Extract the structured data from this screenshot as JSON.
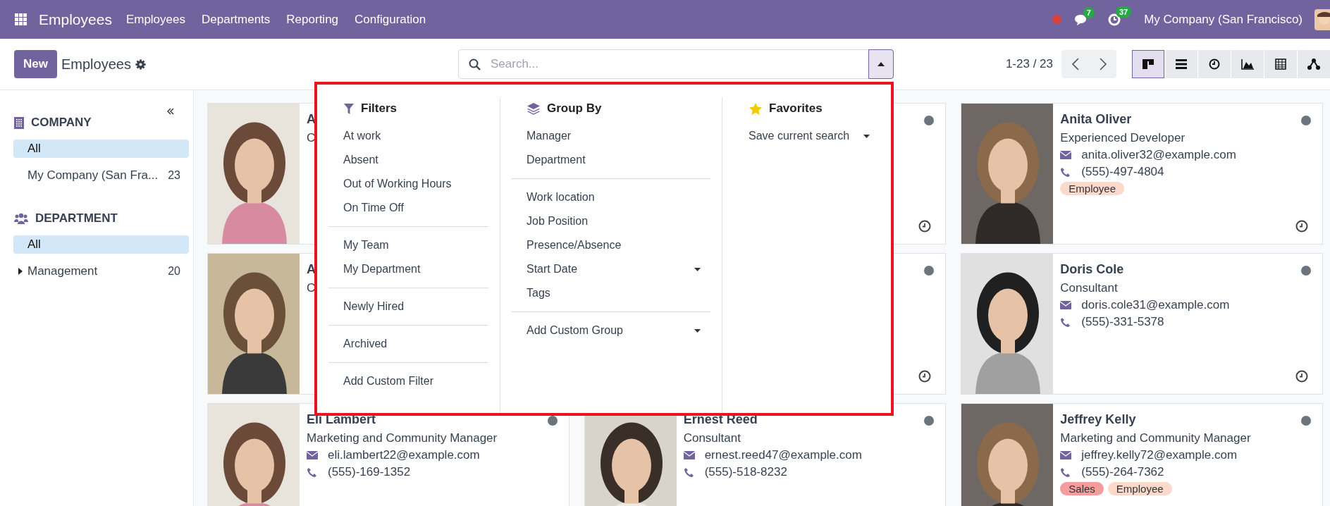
{
  "navbar": {
    "app_title": "Employees",
    "menu": [
      {
        "label": "Employees"
      },
      {
        "label": "Departments"
      },
      {
        "label": "Reporting"
      },
      {
        "label": "Configuration"
      }
    ],
    "messages_count": "7",
    "activities_count": "37",
    "company": "My Company (San Francisco)"
  },
  "control_panel": {
    "new_button": "New",
    "breadcrumb": "Employees",
    "search": {
      "placeholder": "Search...",
      "panel_open": true
    },
    "pager": "1-23 / 23",
    "views": [
      {
        "kind": "kanban",
        "selected": true
      },
      {
        "kind": "list",
        "selected": false
      },
      {
        "kind": "activity",
        "selected": false
      },
      {
        "kind": "graph",
        "selected": false
      },
      {
        "kind": "pivot",
        "selected": false
      },
      {
        "kind": "hierarchy",
        "selected": false
      }
    ]
  },
  "sidebar": {
    "sections": [
      {
        "kind": "company",
        "title": "COMPANY",
        "items": [
          {
            "label": "All",
            "selected": true
          },
          {
            "label": "My Company (San Fra...",
            "count": "23",
            "selected": false
          }
        ]
      },
      {
        "kind": "department",
        "title": "DEPARTMENT",
        "items": [
          {
            "label": "All",
            "selected": true
          },
          {
            "label": "Management",
            "count": "20",
            "selected": false,
            "expanded": false
          }
        ]
      }
    ]
  },
  "search_panel": {
    "filters": {
      "title": "Filters",
      "groups": [
        [
          {
            "label": "At work",
            "kind": "option"
          },
          {
            "label": "Absent",
            "kind": "option"
          },
          {
            "label": "Out of Working Hours",
            "kind": "option"
          },
          {
            "label": "On Time Off",
            "kind": "option"
          }
        ],
        [
          {
            "label": "My Team",
            "kind": "option"
          },
          {
            "label": "My Department",
            "kind": "option"
          }
        ],
        [
          {
            "label": "Newly Hired",
            "kind": "option"
          }
        ],
        [
          {
            "label": "Archived",
            "kind": "option"
          }
        ],
        [
          {
            "label": "Add Custom Filter",
            "kind": "option"
          }
        ]
      ]
    },
    "group_by": {
      "title": "Group By",
      "groups": [
        [
          {
            "label": "Manager",
            "kind": "option"
          },
          {
            "label": "Department",
            "kind": "option"
          }
        ],
        [
          {
            "label": "Work location",
            "kind": "option"
          },
          {
            "label": "Job Position",
            "kind": "option"
          },
          {
            "label": "Presence/Absence",
            "kind": "option"
          },
          {
            "label": "Start Date",
            "kind": "submenu"
          },
          {
            "label": "Tags",
            "kind": "option"
          }
        ],
        [
          {
            "label": "Add Custom Group",
            "kind": "submenu"
          }
        ]
      ]
    },
    "favorites": {
      "title": "Favorites",
      "groups": [
        [
          {
            "label": "Save current search",
            "kind": "submenu"
          }
        ]
      ]
    }
  },
  "cards": [
    {
      "photo": true,
      "name": "A",
      "job": "C"
    },
    {
      "photo": false
    },
    {
      "photo": true,
      "name": "Anita Oliver",
      "job": "Experienced Developer",
      "email": "anita.oliver32@example.com",
      "phone": "(555)-497-4804",
      "tags": [
        {
          "label": "Employee",
          "color": "#fbd9cb"
        }
      ]
    },
    {
      "photo": true,
      "name": "A",
      "job": "C"
    },
    {
      "photo": false
    },
    {
      "photo": true,
      "name": "Doris Cole",
      "job": "Consultant",
      "email": "doris.cole31@example.com",
      "phone": "(555)-331-5378"
    },
    {
      "photo": true,
      "name": "Eli Lambert",
      "job": "Marketing and Community Manager",
      "email": "eli.lambert22@example.com",
      "phone": "(555)-169-1352"
    },
    {
      "photo": true,
      "name": "Ernest Reed",
      "job": "Consultant",
      "email": "ernest.reed47@example.com",
      "phone": "(555)-518-8232"
    },
    {
      "photo": true,
      "name": "Jeffrey Kelly",
      "job": "Marketing and Community Manager",
      "email": "jeffrey.kelly72@example.com",
      "phone": "(555)-264-7362",
      "tags": [
        {
          "label": "Sales",
          "color": "#f79c9c"
        },
        {
          "label": "Employee",
          "color": "#fbd9cb"
        }
      ]
    }
  ]
}
